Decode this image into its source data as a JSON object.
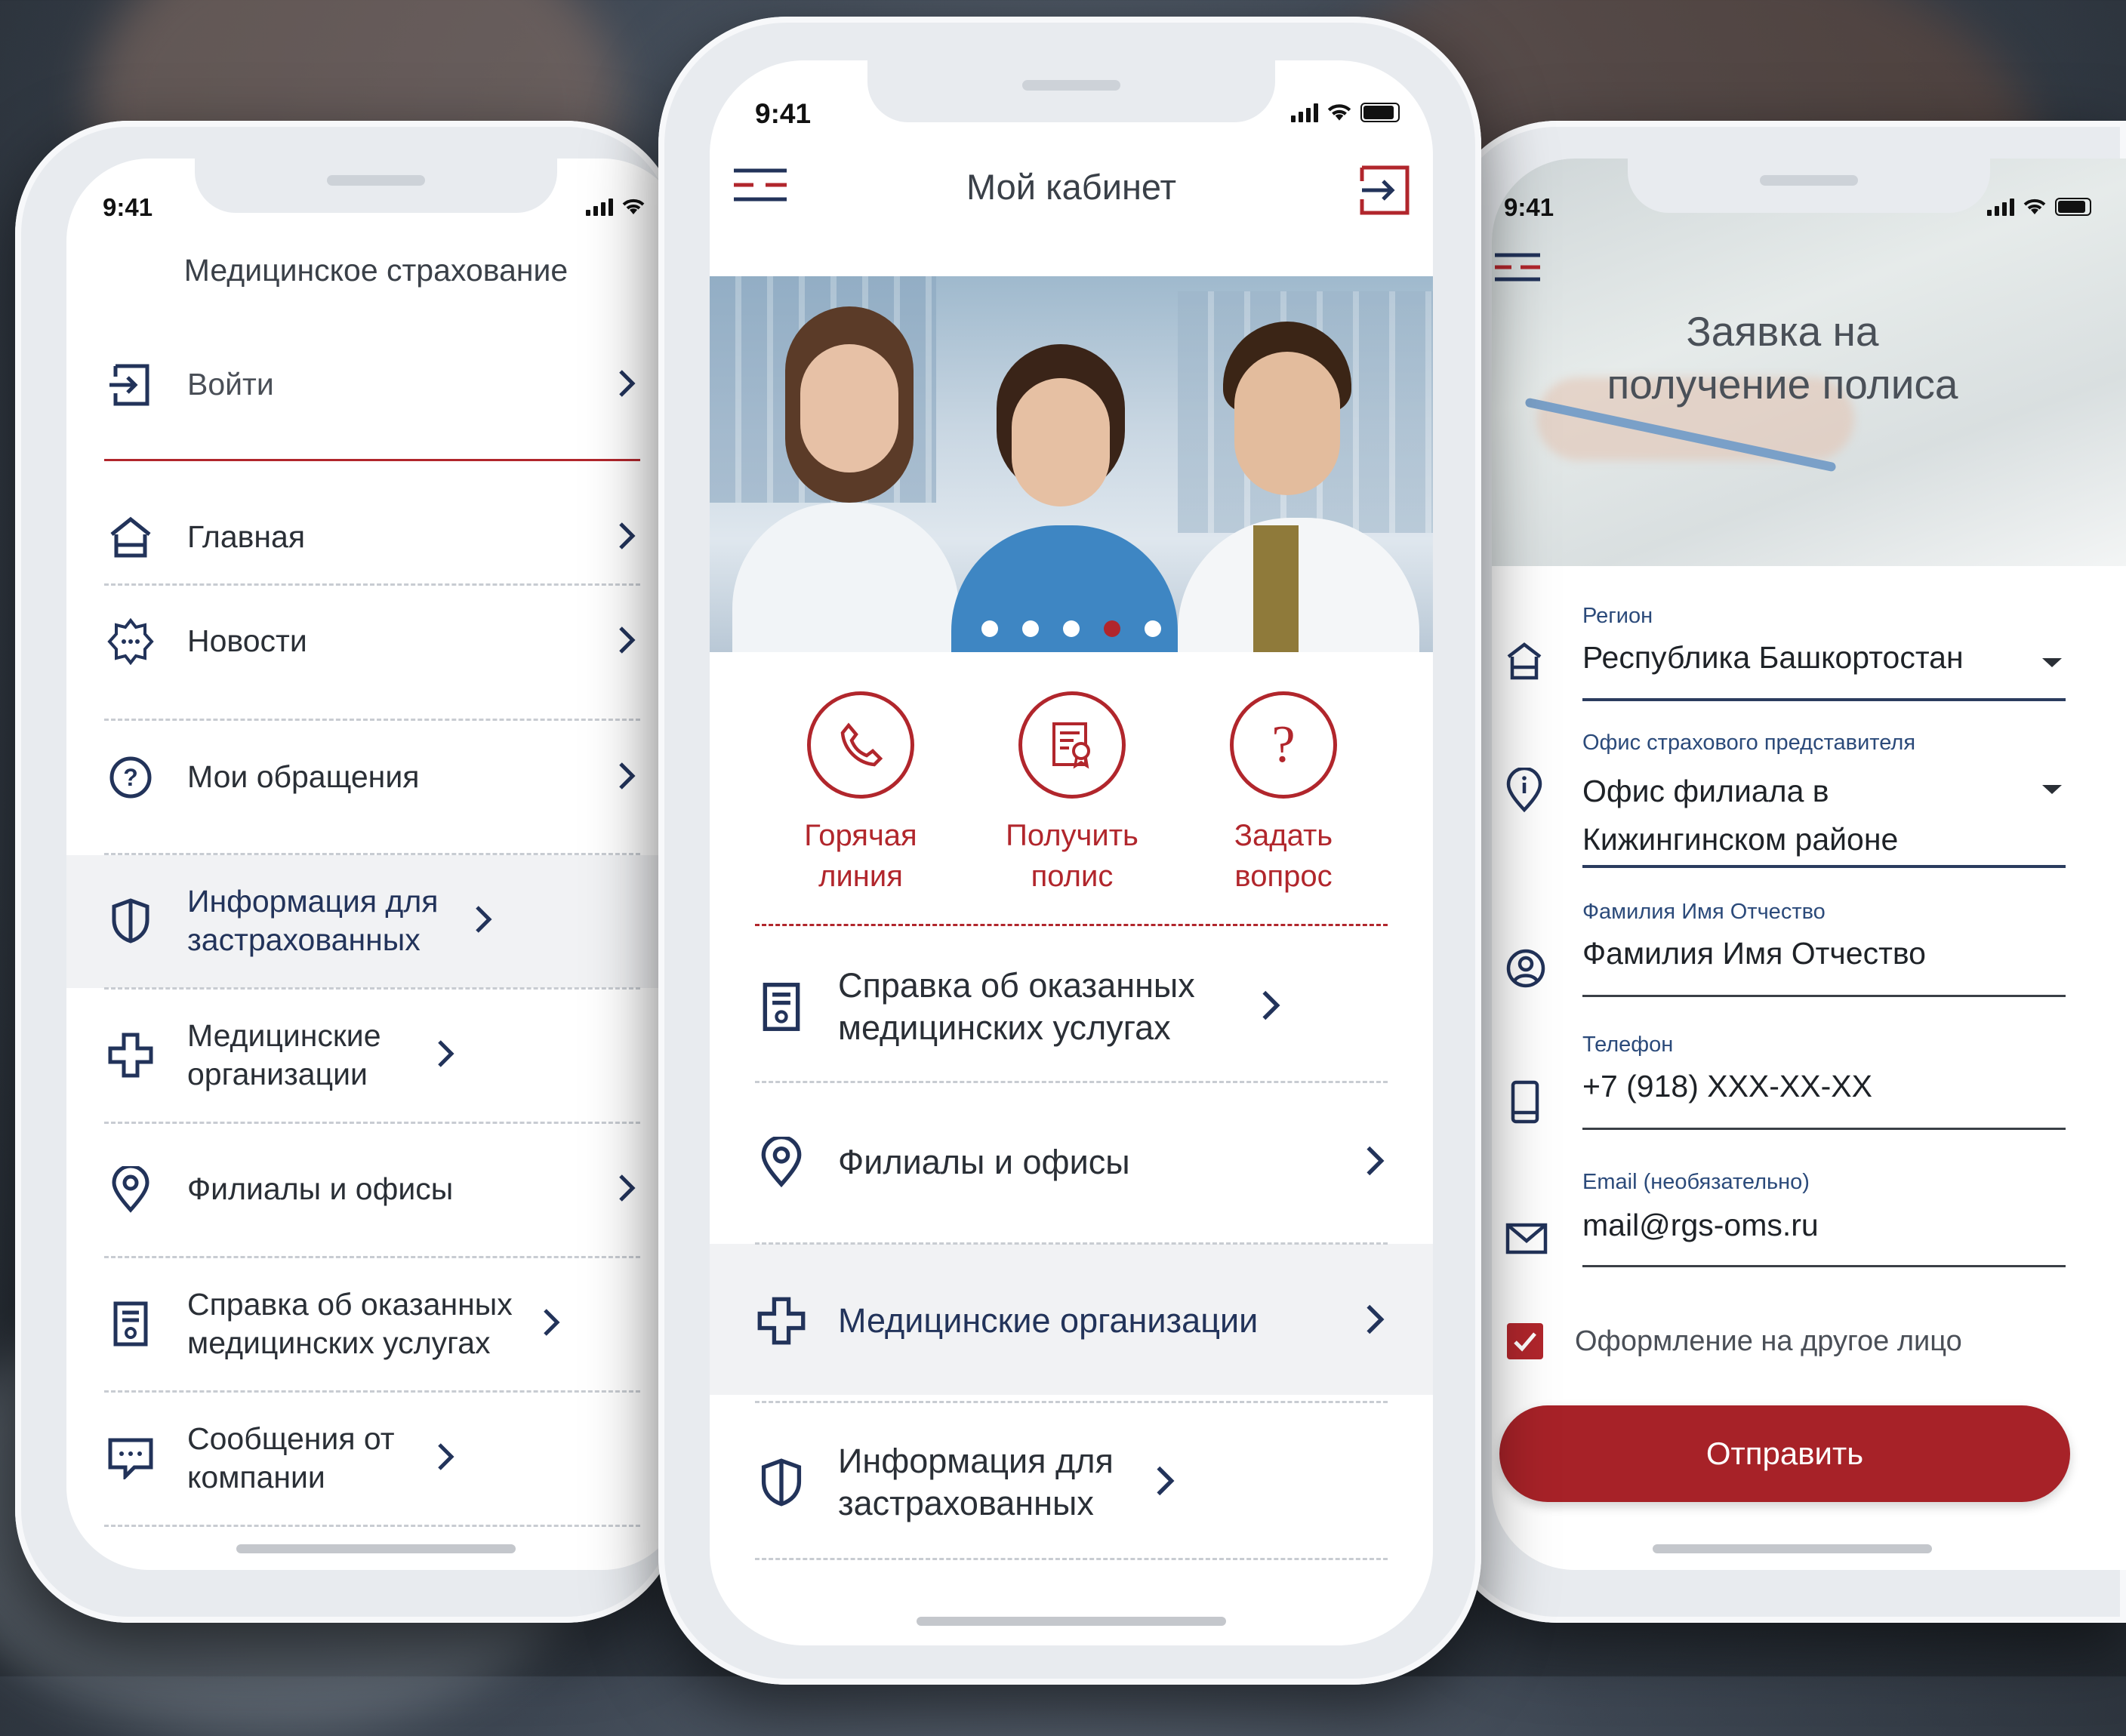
{
  "left_phone": {
    "status_time": "9:41",
    "title": "Медицинское страхование",
    "login_label": "Войти",
    "menu": [
      {
        "label": "Главная",
        "icon": "home-icon"
      },
      {
        "label": "Новости",
        "icon": "news-icon"
      },
      {
        "label": "Мои обращения",
        "icon": "question-icon"
      },
      {
        "label": "Информация для застрахованных",
        "icon": "shield-icon"
      },
      {
        "label": "Медицинские организации",
        "icon": "medical-cross-icon"
      },
      {
        "label": "Филиалы и офисы",
        "icon": "location-pin-icon"
      },
      {
        "label": "Справка об оказанных медицинских услугах",
        "icon": "document-icon"
      },
      {
        "label": "Сообщения от компании",
        "icon": "message-icon"
      }
    ]
  },
  "center_phone": {
    "status_time": "9:41",
    "title": "Мой кабинет",
    "carousel": {
      "slides": 5,
      "active": 3
    },
    "actions": [
      {
        "label": "Горячая линия",
        "icon": "phone-icon"
      },
      {
        "label": "Получить полис",
        "icon": "certificate-icon"
      },
      {
        "label": "Задать вопрос",
        "icon": "question-icon"
      }
    ],
    "menu": [
      {
        "label": "Справка об оказанных медицинских услугах",
        "icon": "document-icon"
      },
      {
        "label": "Филиалы и офисы",
        "icon": "location-pin-icon"
      },
      {
        "label": "Медицинские организации",
        "icon": "medical-cross-icon"
      },
      {
        "label": "Информация для застрахованных",
        "icon": "shield-icon"
      }
    ]
  },
  "right_phone": {
    "status_time": "9:41",
    "title": "Заявка на получение полиса",
    "fields": {
      "region": {
        "label": "Регион",
        "value": "Республика Башкортостан"
      },
      "office": {
        "label": "Офис страхового представителя",
        "value": "Офис филиала в Кижингинском районе"
      },
      "fio": {
        "label": "Фамилия Имя Отчество",
        "value": "Фамилия Имя Отчество"
      },
      "phone": {
        "label": "Телефон",
        "value": "+7 (918) XXX-XX-XX"
      },
      "email": {
        "label": "Email (необязательно)",
        "value": "mail@rgs-oms.ru"
      }
    },
    "checkbox": {
      "label": "Оформление на другое лицо",
      "checked": true
    },
    "submit_label": "Отправить"
  },
  "colors": {
    "brand_red": "#b1262c",
    "navy": "#22335a"
  }
}
